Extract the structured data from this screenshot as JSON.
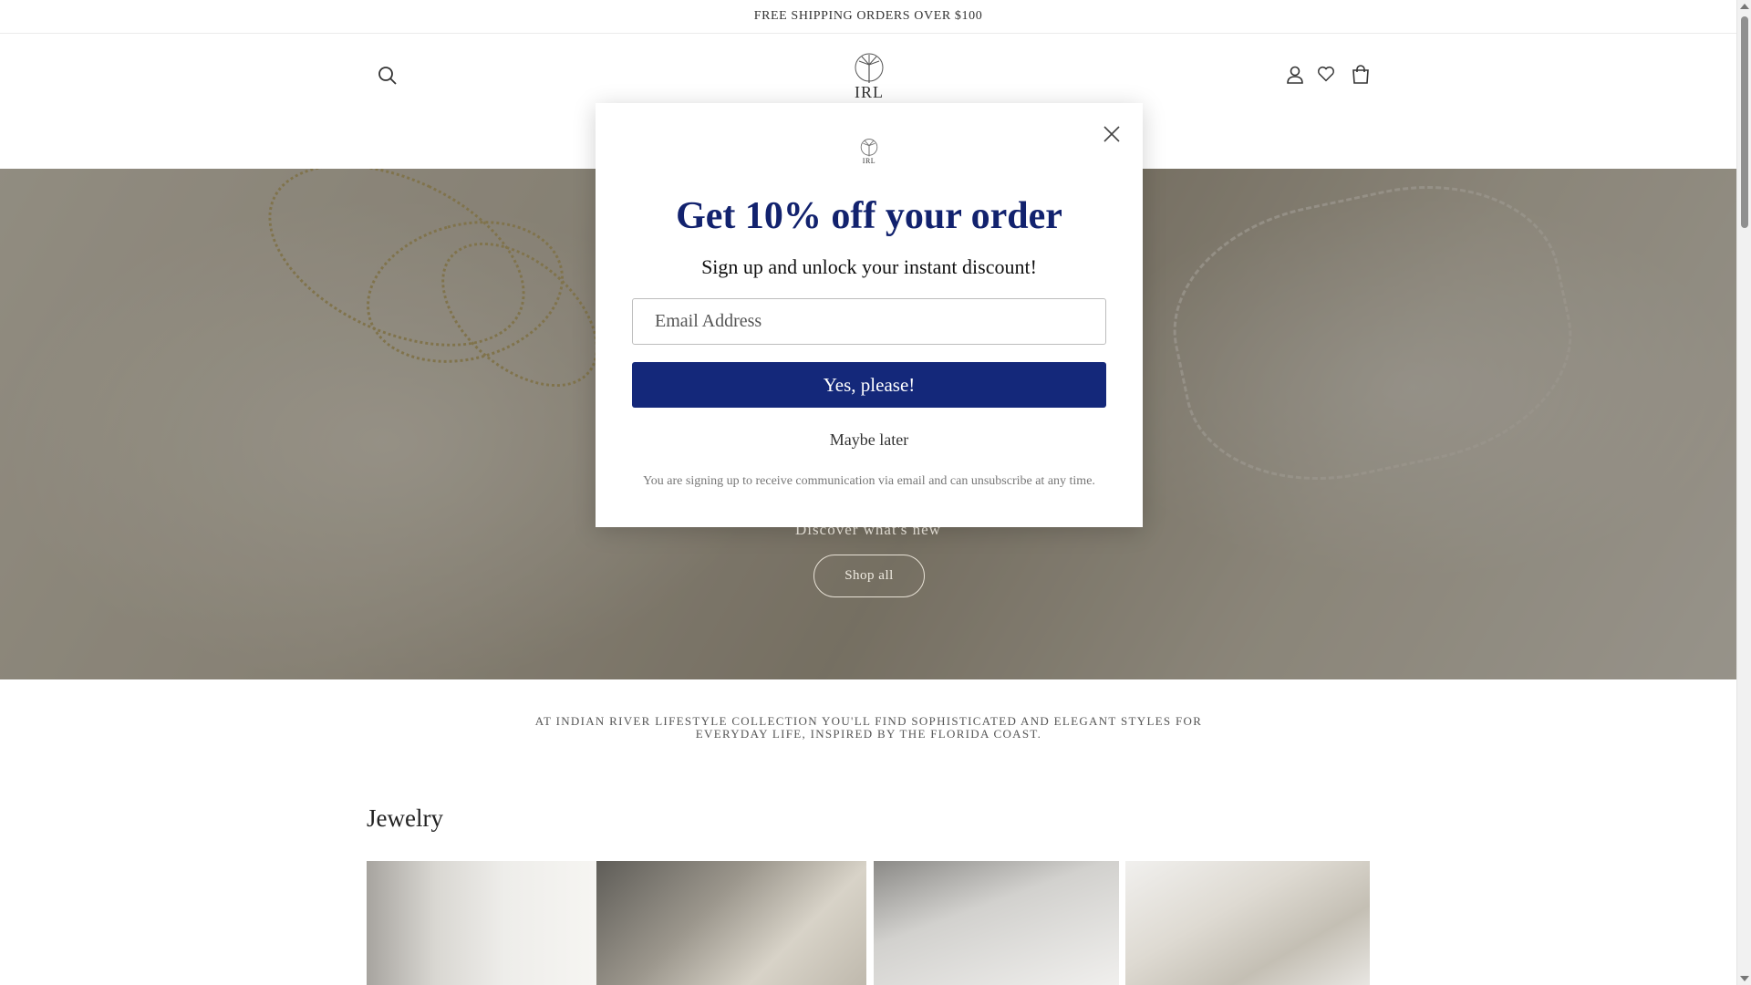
{
  "announcement": {
    "text": "FREE SHIPPING ORDERS OVER $100"
  },
  "header": {
    "logo_text": "IRL",
    "icons": [
      "search-icon",
      "account-icon",
      "wishlist-heart-icon",
      "cart-icon"
    ]
  },
  "hero": {
    "subtitle": "Discover what's new",
    "button_label": "Shop all"
  },
  "tagline": "AT INDIAN RIVER LIFESTYLE COLLECTION YOU'LL FIND SOPHISTICATED AND ELEGANT STYLES FOR EVERYDAY LIFE, INSPIRED BY THE FLORIDA COAST.",
  "collection": {
    "title": "Jewelry"
  },
  "modal": {
    "logo_text": "IRL",
    "title": "Get 10% off your order",
    "subtitle": "Sign up and unlock your instant discount!",
    "email_placeholder": "Email Address",
    "submit_label": "Yes, please!",
    "dismiss_label": "Maybe later",
    "legal": "You are signing up to receive communication via email and can unsubscribe at any time."
  },
  "colors": {
    "modal_title": "#12226e",
    "modal_button": "#14287a",
    "hero_overlay": "rgba(60,55,45,0.45)"
  }
}
